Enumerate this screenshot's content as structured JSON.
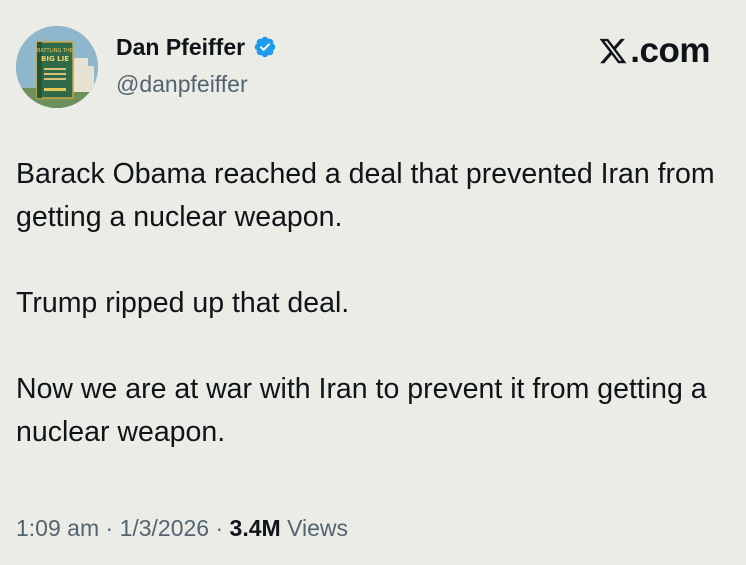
{
  "author": {
    "display_name": "Dan Pfeiffer",
    "handle": "@danpfeiffer",
    "verified": true,
    "avatar_icon": "book-cover-avatar",
    "avatar_book_text": "BATTLING THE BIG LIE"
  },
  "brand": {
    "icon": "x-logo-icon",
    "text": ".com"
  },
  "tweet": {
    "paragraphs": [
      "Barack Obama reached a deal that prevented Iran from getting a nuclear weapon.",
      "Trump ripped up that deal.",
      "Now we are at war with Iran to prevent it from getting a nuclear weapon."
    ]
  },
  "meta": {
    "time": "1:09 am",
    "separator": " · ",
    "date": "1/3/2026",
    "views_count": "3.4M",
    "views_label": " Views"
  },
  "colors": {
    "background": "#ecece6",
    "text": "#0f1419",
    "secondary": "#536471",
    "verified": "#1d9bf0"
  }
}
